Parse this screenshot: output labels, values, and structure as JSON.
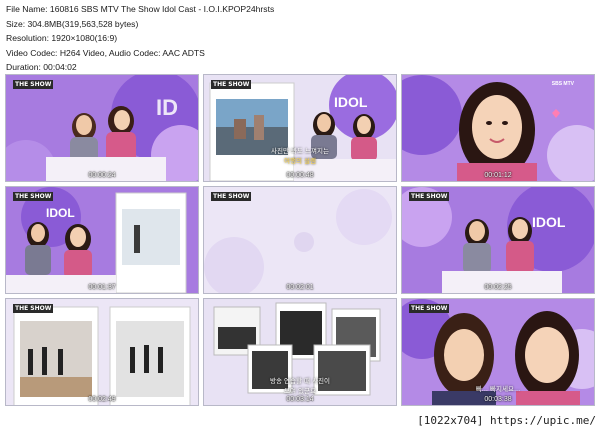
{
  "info": {
    "file_name": "File Name: 160816 SBS MTV The Show Idol Cast - I.O.I.KPOP24hrsts",
    "size": "Size: 304.8MB(319,563,528 bytes)",
    "resolution": "Resolution: 1920×1080(16:9)",
    "codec": "Video Codec: H264 Video, Audio Codec: AAC ADTS",
    "duration": "Duration: 00:04:02"
  },
  "logo_text": "THE SHOW",
  "channel_text": "SBS MTV",
  "idol_cast_text": "IDOL CAST",
  "thumbnails": [
    {
      "timestamp": "00:00:24"
    },
    {
      "timestamp": "00:00:48",
      "subtitle_top": "사진만 봐도 느껴지는",
      "subtitle_bottom": "여행의 설렘"
    },
    {
      "timestamp": "00:01:12"
    },
    {
      "timestamp": "00:01:37"
    },
    {
      "timestamp": "00:02:01"
    },
    {
      "timestamp": "00:02:25"
    },
    {
      "timestamp": "00:02:49"
    },
    {
      "timestamp": "00:03:14",
      "subtitle_top": "방송 연습할 때 사진이",
      "subtitle_bottom": "모여 있군요"
    },
    {
      "timestamp": "00:03:38",
      "subtitle_top": "빠... 빠지세요..."
    }
  ],
  "watermark": "[1022x704] https://upic.me/",
  "colors": {
    "studio_purple": "#8a5bd6",
    "studio_light": "#c9b3ee",
    "studio_pale": "#e9e2f7",
    "background": "#ffffff"
  }
}
